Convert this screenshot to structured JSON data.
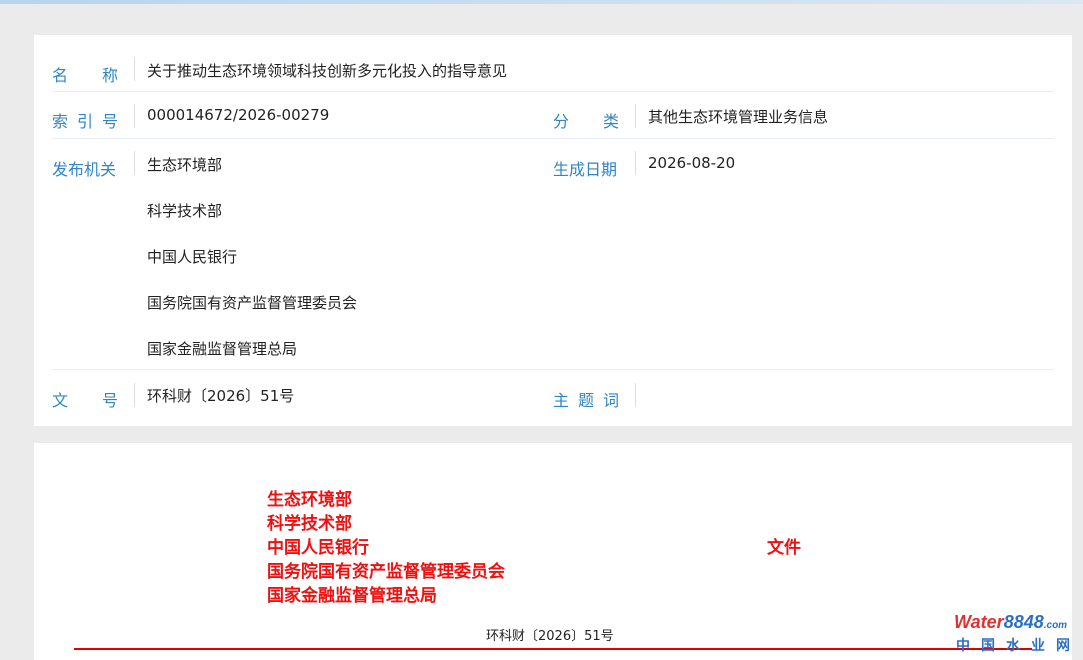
{
  "info": {
    "name_label": [
      "名",
      "称"
    ],
    "name_value": "关于推动生态环境领域科技创新多元化投入的指导意见",
    "index_label": [
      "索",
      "引",
      "号"
    ],
    "index_value": "000014672/2026-00279",
    "category_label": [
      "分",
      "类"
    ],
    "category_value": "其他生态环境管理业务信息",
    "issuer_label": "发布机关",
    "issuers": [
      "生态环境部",
      "科学技术部",
      "中国人民银行",
      "国务院国有资产监督管理委员会",
      "国家金融监督管理总局"
    ],
    "date_label": "生成日期",
    "date_value": "2026-08-20",
    "docno_label": [
      "文",
      "号"
    ],
    "docno_value": "环科财〔2026〕51号",
    "subject_label": [
      "主",
      "题",
      "词"
    ],
    "subject_value": ""
  },
  "document": {
    "agencies": [
      "生态环境部",
      "科学技术部",
      "中国人民银行",
      "国务院国有资产监督管理委员会",
      "国家金融监督管理总局"
    ],
    "wenjian": "文件",
    "docno": "环科财〔2026〕51号"
  },
  "watermark": {
    "top_a": "Water",
    "top_b": "8848",
    "top_c": ".com",
    "bottom": "中国水业网"
  },
  "colors": {
    "label_blue": "#2f86c5",
    "red": "#ee1111"
  }
}
